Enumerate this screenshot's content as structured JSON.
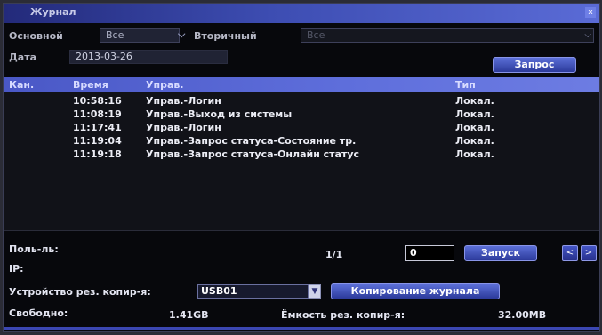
{
  "window": {
    "title": "Журнал",
    "close_label": "x"
  },
  "filters": {
    "main_label": "Основной",
    "main_value": "Все",
    "secondary_label": "Вторичный",
    "secondary_value": "Все",
    "date_label": "Дата",
    "date_value": "2013-03-26",
    "search_label": "Запрос"
  },
  "table": {
    "columns": {
      "channel": "Кан.",
      "time": "Время",
      "control": "Управ.",
      "type": "Тип"
    },
    "rows": [
      {
        "time": "10:58:16",
        "control": "Управ.-Логин",
        "type": "Локал."
      },
      {
        "time": "11:08:19",
        "control": "Управ.-Выход из системы",
        "type": "Локал."
      },
      {
        "time": "11:17:41",
        "control": "Управ.-Логин",
        "type": "Локал."
      },
      {
        "time": "11:19:04",
        "control": "Управ.-Запрос статуса-Состояние тр.",
        "type": "Локал."
      },
      {
        "time": "11:19:18",
        "control": "Управ.-Запрос статуса-Онлайн статус",
        "type": "Локал."
      }
    ]
  },
  "pager": {
    "user_label": "Поль-ль:",
    "ip_label": "IP:",
    "page": "1/1",
    "page_input": "0",
    "go_label": "Запуск",
    "prev_icon": "<",
    "next_icon": ">"
  },
  "backup": {
    "device_label": "Устройство рез. копир-я:",
    "device_value": "USB01",
    "copy_label": "Копирование журнала",
    "free_label": "Свободно:",
    "free_value": "1.41GB",
    "capacity_label": "Ёмкость рез. копир-я:",
    "capacity_value": "32.00MB"
  }
}
